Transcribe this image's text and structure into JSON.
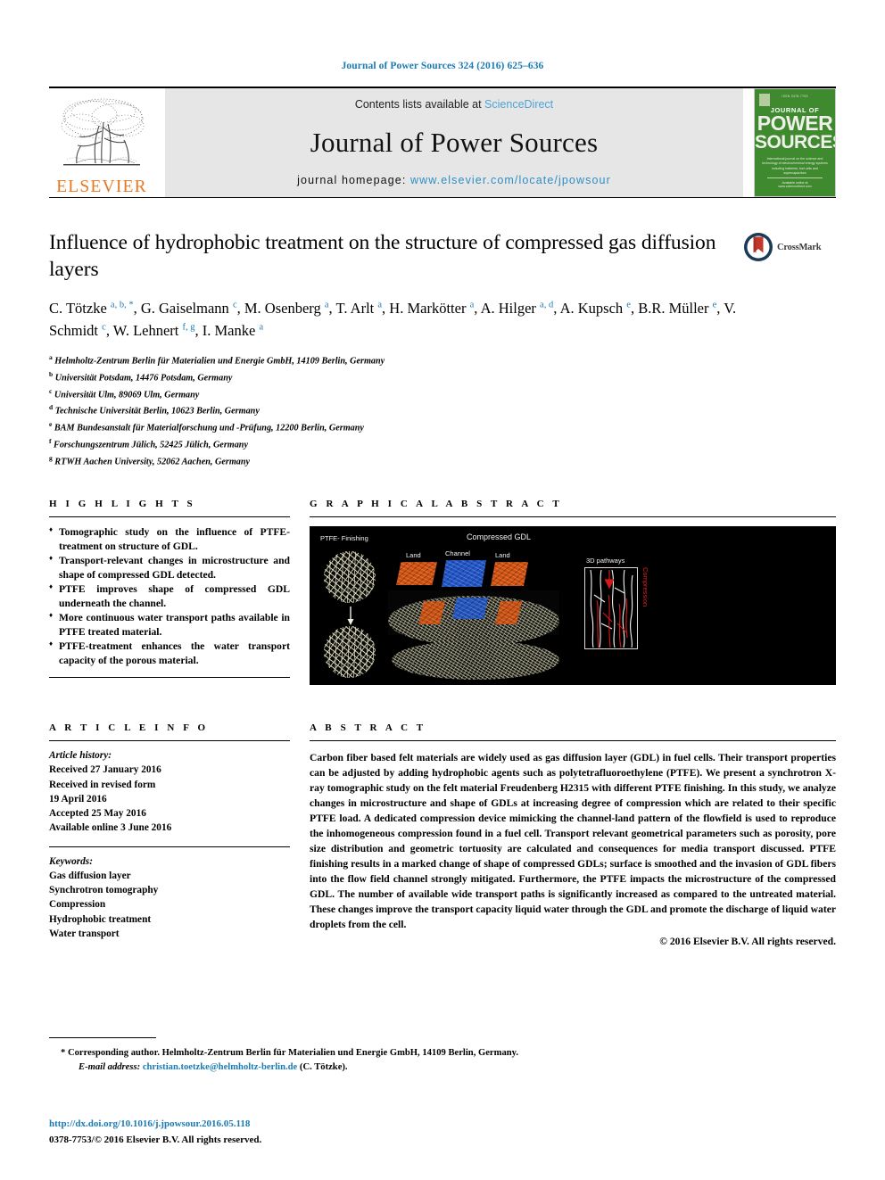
{
  "running_head": "Journal of Power Sources 324 (2016) 625–636",
  "masthead": {
    "publisher_wordmark": "ELSEVIER",
    "contents_prefix": "Contents lists available at ",
    "contents_link": "ScienceDirect",
    "journal_title": "Journal of Power Sources",
    "homepage_prefix": "journal homepage: ",
    "homepage_link": "www.elsevier.com/locate/jpowsour",
    "cover": {
      "top_caption": "ISSN 0378-7753",
      "line1": "JOURNAL OF",
      "line2_left": "P",
      "line2_mid": "OWE",
      "line2_right": "R",
      "line2": "POWER",
      "line3": "SOURCES",
      "description": "International journal on the science and technology of electrochemical energy systems including batteries, fuel cells and supercapacitors",
      "footer": "Available online at www.sciencedirect.com"
    }
  },
  "title": "Influence of hydrophobic treatment on the structure of compressed gas diffusion layers",
  "crossmark_label": "CrossMark",
  "authors": [
    {
      "name": "C. Tötzke",
      "marks": "a, b, *"
    },
    {
      "name": "G. Gaiselmann",
      "marks": "c"
    },
    {
      "name": "M. Osenberg",
      "marks": "a"
    },
    {
      "name": "T. Arlt",
      "marks": "a"
    },
    {
      "name": "H. Markötter",
      "marks": "a"
    },
    {
      "name": "A. Hilger",
      "marks": "a, d"
    },
    {
      "name": "A. Kupsch",
      "marks": "e"
    },
    {
      "name": "B.R. Müller",
      "marks": "e"
    },
    {
      "name": "V. Schmidt",
      "marks": "c"
    },
    {
      "name": "W. Lehnert",
      "marks": "f, g"
    },
    {
      "name": "I. Manke",
      "marks": "a"
    }
  ],
  "affiliations": [
    {
      "mark": "a",
      "text": "Helmholtz-Zentrum Berlin für Materialien und Energie GmbH, 14109 Berlin, Germany"
    },
    {
      "mark": "b",
      "text": "Universität Potsdam, 14476 Potsdam, Germany"
    },
    {
      "mark": "c",
      "text": "Universität Ulm, 89069 Ulm, Germany"
    },
    {
      "mark": "d",
      "text": "Technische Universität Berlin, 10623 Berlin, Germany"
    },
    {
      "mark": "e",
      "text": "BAM Bundesanstalt für Materialforschung und -Prüfung, 12200 Berlin, Germany"
    },
    {
      "mark": "f",
      "text": "Forschungszentrum Jülich, 52425 Jülich, Germany"
    },
    {
      "mark": "g",
      "text": "RTWH Aachen University, 52062 Aachen, Germany"
    }
  ],
  "highlights": {
    "heading": "H I G H L I G H T S",
    "items": [
      "Tomographic study on the influence of PTFE-treatment on structure of GDL.",
      "Transport-relevant changes in microstructure and shape of compressed GDL detected.",
      "PTFE improves shape of compressed GDL underneath the channel.",
      "More continuous water transport paths available in PTFE treated material.",
      "PTFE-treatment enhances the water transport capacity of the porous material."
    ]
  },
  "graphical_abstract": {
    "heading": "G R A P H I C A L   A B S T R A C T",
    "labels": {
      "ptfe_finishing": "PTFE- Finishing",
      "compressed_gdl": "Compressed GDL",
      "land_left": "Land",
      "channel": "Channel",
      "land_right": "Land",
      "pathways": "3D pathways",
      "compression": "Compression"
    },
    "colors": {
      "land": "#d2500d",
      "channel": "#1f55c8",
      "compression_arrow": "#e02020",
      "background": "#000000"
    }
  },
  "article_info": {
    "heading": "A R T I C L E   I N F O",
    "history_label": "Article history:",
    "history": [
      "Received 27 January 2016",
      "Received in revised form",
      "19 April 2016",
      "Accepted 25 May 2016",
      "Available online 3 June 2016"
    ],
    "keywords_label": "Keywords:",
    "keywords": [
      "Gas diffusion layer",
      "Synchrotron tomography",
      "Compression",
      "Hydrophobic treatment",
      "Water transport"
    ]
  },
  "abstract": {
    "heading": "A B S T R A C T",
    "text": "Carbon fiber based felt materials are widely used as gas diffusion layer (GDL) in fuel cells. Their transport properties can be adjusted by adding hydrophobic agents such as polytetrafluoroethylene (PTFE). We present a synchrotron X-ray tomographic study on the felt material Freudenberg H2315 with different PTFE finishing. In this study, we analyze changes in microstructure and shape of GDLs at increasing degree of compression which are related to their specific PTFE load. A dedicated compression device mimicking the channel-land pattern of the flowfield is used to reproduce the inhomogeneous compression found in a fuel cell. Transport relevant geometrical parameters such as porosity, pore size distribution and geometric tortuosity are calculated and consequences for media transport discussed. PTFE finishing results in a marked change of shape of compressed GDLs; surface is smoothed and the invasion of GDL fibers into the flow field channel strongly mitigated. Furthermore, the PTFE impacts the microstructure of the compressed GDL. The number of available wide transport paths is significantly increased as compared to the untreated material. These changes improve the transport capacity liquid water through the GDL and promote the discharge of liquid water droplets from the cell.",
    "copyright": "© 2016 Elsevier B.V. All rights reserved."
  },
  "footer": {
    "corresponding_marker": "*",
    "corresponding": "Corresponding author. Helmholtz-Zentrum Berlin für Materialien und Energie GmbH, 14109 Berlin, Germany.",
    "email_label": "E-mail address:",
    "email": "christian.toetzke@helmholtz-berlin.de",
    "email_suffix": "(C. Tötzke).",
    "doi": "http://dx.doi.org/10.1016/j.jpowsour.2016.05.118",
    "issn_line": "0378-7753/© 2016 Elsevier B.V. All rights reserved."
  }
}
